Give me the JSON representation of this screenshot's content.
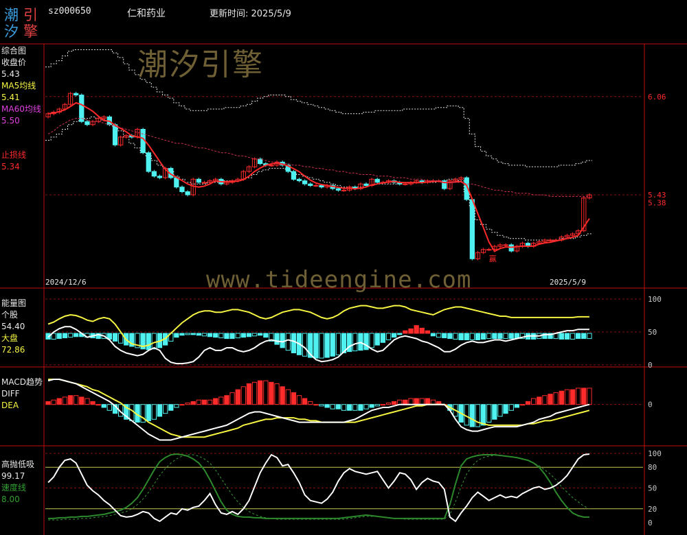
{
  "header": {
    "logo_chars": [
      "潮",
      "引",
      "汐",
      "擎"
    ],
    "code": "sz000650",
    "name": "仁和药业",
    "update_label": "更新时间: 2025/5/9"
  },
  "watermarks": {
    "cn": "潮汐引擎",
    "url": "www.tideengine.com"
  },
  "colors": {
    "red": "#ff2a2a",
    "cyan": "#4ef0f0",
    "yellow": "#f5f542",
    "white": "#ffffff",
    "green": "#2c8a2c",
    "magenta": "#e040e0",
    "frame": "#c01010"
  },
  "panel1": {
    "title": "综合图",
    "close_label": "收盘价",
    "close_value": "5.43",
    "ma5_label": "MA5均线",
    "ma5_value": "5.41",
    "ma60_label": "MA60均线",
    "ma60_value": "5.50",
    "stop_label": "止损线",
    "stop_value": "5.34",
    "date_start": "2024/12/6",
    "date_end": "2025/5/9",
    "marker": "赢"
  },
  "panel2": {
    "title": "能量图",
    "stock_label": "个股",
    "stock_value": "54.40",
    "market_label": "大盘",
    "market_value": "72.86"
  },
  "panel3": {
    "title": "MACD趋势",
    "diff_label": "DIFF",
    "dea_label": "DEA"
  },
  "panel4": {
    "title": "高抛低吸",
    "main_value": "99.17",
    "speed_label": "速度线",
    "speed_value": "8.00"
  },
  "chart_data": [
    {
      "type": "candlestick",
      "title": "综合图",
      "x_range": [
        "2024/12/6",
        "2025/5/9"
      ],
      "y_tick_labels": [
        "6.06",
        "5.43",
        "5.38"
      ],
      "ylim": [
        4.85,
        6.38
      ],
      "closes": [
        5.95,
        5.96,
        5.98,
        6.01,
        6.08,
        6.07,
        5.9,
        5.88,
        5.9,
        5.92,
        5.93,
        5.88,
        5.75,
        5.8,
        5.81,
        5.8,
        5.85,
        5.7,
        5.58,
        5.55,
        5.54,
        5.6,
        5.54,
        5.48,
        5.45,
        5.43,
        5.53,
        5.51,
        5.51,
        5.52,
        5.53,
        5.5,
        5.51,
        5.52,
        5.53,
        5.58,
        5.61,
        5.66,
        5.63,
        5.62,
        5.62,
        5.64,
        5.62,
        5.58,
        5.53,
        5.52,
        5.5,
        5.49,
        5.49,
        5.48,
        5.49,
        5.47,
        5.46,
        5.46,
        5.48,
        5.47,
        5.5,
        5.49,
        5.53,
        5.51,
        5.51,
        5.52,
        5.51,
        5.5,
        5.5,
        5.51,
        5.52,
        5.51,
        5.52,
        5.52,
        5.52,
        5.47,
        5.52,
        5.53,
        5.54,
        5.4,
        5.02,
        5.06,
        5.08,
        5.08,
        5.1,
        5.11,
        5.11,
        5.07,
        5.1,
        5.12,
        5.1,
        5.12,
        5.13,
        5.14,
        5.14,
        5.14,
        5.16,
        5.17,
        5.18,
        5.2,
        5.41,
        5.43
      ],
      "stop_line": [
        5.78,
        5.8,
        5.82,
        5.85,
        5.88,
        5.9,
        5.91,
        5.92,
        5.93,
        5.92,
        5.91,
        5.9,
        5.87,
        5.84,
        5.8,
        5.76,
        5.73,
        5.7,
        5.68,
        5.65,
        5.62,
        5.6,
        5.58,
        5.55,
        5.53,
        5.51,
        5.5,
        5.5,
        5.5,
        5.51,
        5.51,
        5.51,
        5.52,
        5.52,
        5.52,
        5.53,
        5.54,
        5.56,
        5.58,
        5.59,
        5.6,
        5.6,
        5.6,
        5.59,
        5.57,
        5.56,
        5.55,
        5.54,
        5.53,
        5.52,
        5.51,
        5.5,
        5.49,
        5.48,
        5.48,
        5.48,
        5.48,
        5.49,
        5.49,
        5.5,
        5.5,
        5.5,
        5.5,
        5.5,
        5.51,
        5.51,
        5.51,
        5.51,
        5.51,
        5.51,
        5.52,
        5.52,
        5.53,
        5.53,
        5.52,
        5.45,
        5.35,
        5.27,
        5.24,
        5.21,
        5.19,
        5.17,
        5.16,
        5.15,
        5.15,
        5.15,
        5.14,
        5.14,
        5.14,
        5.14,
        5.14,
        5.14,
        5.15,
        5.15,
        5.15,
        5.16,
        5.17,
        5.18
      ],
      "ma60": [
        5.82,
        5.84,
        5.87,
        5.89,
        5.91,
        5.92,
        5.92,
        5.91,
        5.9,
        5.9,
        5.89,
        5.88,
        5.87,
        5.86,
        5.85,
        5.84,
        5.83,
        5.82,
        5.81,
        5.8,
        5.79,
        5.78,
        5.77,
        5.76,
        5.76,
        5.75,
        5.74,
        5.73,
        5.73,
        5.72,
        5.71,
        5.7,
        5.7,
        5.69,
        5.68,
        5.68,
        5.67,
        5.66,
        5.66,
        5.65,
        5.64,
        5.64,
        5.63,
        5.63,
        5.62,
        5.62,
        5.61,
        5.61,
        5.6,
        5.6,
        5.59,
        5.59,
        5.58,
        5.58,
        5.57,
        5.57,
        5.56,
        5.56,
        5.56,
        5.55,
        5.55,
        5.55,
        5.54,
        5.54,
        5.54,
        5.53,
        5.53,
        5.53,
        5.52,
        5.52,
        5.52,
        5.51,
        5.51,
        5.51,
        5.51,
        5.5,
        5.5,
        5.49,
        5.48,
        5.47,
        5.46,
        5.46,
        5.45,
        5.45,
        5.44,
        5.44,
        5.44,
        5.43,
        5.43,
        5.43,
        5.42,
        5.42,
        5.42,
        5.42,
        5.42,
        5.42,
        5.42,
        5.42
      ]
    },
    {
      "type": "bar+line",
      "title": "能量图",
      "y_tick_labels": [
        "100",
        "50",
        "0"
      ],
      "ylim": [
        0,
        100
      ],
      "bars": [
        -9,
        -9,
        -8,
        -7,
        -6,
        -5,
        -5,
        -6,
        -7,
        -8,
        -8,
        -9,
        -12,
        -15,
        -18,
        -20,
        -22,
        -24,
        -25,
        -24,
        -22,
        -18,
        -12,
        -6,
        -3,
        -2,
        -2,
        -3,
        -4,
        -5,
        -6,
        -7,
        -8,
        -8,
        -7,
        -6,
        -5,
        -4,
        -3,
        -6,
        -12,
        -17,
        -22,
        -26,
        -30,
        -33,
        -35,
        -37,
        -38,
        -38,
        -37,
        -35,
        -33,
        -30,
        -28,
        -27,
        -26,
        -25,
        -22,
        -18,
        -14,
        -10,
        -6,
        -2,
        4,
        7,
        12,
        8,
        4,
        -4,
        -6,
        -7,
        -8,
        -9,
        -10,
        -10,
        -10,
        -10,
        -9,
        -8,
        -8,
        -8,
        -8,
        -8,
        -8,
        -8,
        -9,
        -9,
        -8,
        -8,
        -8,
        -8,
        -9,
        -9,
        -9,
        -8,
        -8,
        -8
      ],
      "stock_line": [
        42,
        50,
        55,
        58,
        58,
        54,
        48,
        42,
        44,
        46,
        44,
        38,
        28,
        22,
        18,
        16,
        14,
        16,
        22,
        26,
        22,
        10,
        4,
        2,
        2,
        3,
        5,
        12,
        22,
        26,
        22,
        22,
        26,
        26,
        22,
        20,
        22,
        26,
        32,
        36,
        38,
        36,
        35,
        38,
        36,
        32,
        26,
        16,
        8,
        5,
        6,
        8,
        12,
        20,
        28,
        32,
        34,
        30,
        24,
        20,
        22,
        30,
        38,
        42,
        44,
        42,
        40,
        36,
        34,
        30,
        26,
        20,
        20,
        24,
        30,
        34,
        36,
        34,
        34,
        36,
        38,
        38,
        36,
        38,
        40,
        42,
        44,
        44,
        44,
        46,
        46,
        48,
        50,
        52,
        52,
        54,
        54,
        54
      ],
      "market_line": [
        62,
        65,
        70,
        74,
        76,
        75,
        72,
        68,
        66,
        70,
        72,
        70,
        62,
        50,
        38,
        32,
        30,
        28,
        30,
        34,
        36,
        40,
        48,
        56,
        64,
        70,
        76,
        80,
        82,
        82,
        80,
        80,
        82,
        84,
        84,
        82,
        80,
        76,
        72,
        70,
        72,
        76,
        80,
        82,
        84,
        84,
        82,
        80,
        76,
        72,
        70,
        72,
        76,
        82,
        86,
        88,
        90,
        90,
        88,
        86,
        86,
        88,
        90,
        90,
        88,
        84,
        82,
        80,
        78,
        76,
        80,
        84,
        86,
        88,
        88,
        86,
        84,
        82,
        80,
        78,
        76,
        74,
        74,
        72,
        72,
        72,
        72,
        72,
        72,
        72,
        72,
        72,
        72,
        72,
        72,
        73,
        73,
        73
      ]
    },
    {
      "type": "bar+line",
      "title": "MACD趋势",
      "y_tick_labels": [
        "0"
      ],
      "ylim": [
        -0.27,
        0.23
      ],
      "macd_bars": [
        0.02,
        0.03,
        0.04,
        0.05,
        0.06,
        0.06,
        0.05,
        0.04,
        0.02,
        0.0,
        -0.02,
        -0.04,
        -0.06,
        -0.08,
        -0.1,
        -0.11,
        -0.12,
        -0.12,
        -0.11,
        -0.1,
        -0.08,
        -0.06,
        -0.04,
        -0.02,
        0.0,
        0.01,
        0.02,
        0.03,
        0.03,
        0.03,
        0.04,
        0.05,
        0.06,
        0.08,
        0.1,
        0.12,
        0.14,
        0.15,
        0.16,
        0.16,
        0.15,
        0.14,
        0.12,
        0.1,
        0.08,
        0.06,
        0.04,
        0.02,
        0.0,
        -0.01,
        -0.02,
        -0.03,
        -0.03,
        -0.04,
        -0.04,
        -0.04,
        -0.04,
        -0.03,
        -0.02,
        -0.01,
        0.0,
        0.01,
        0.02,
        0.03,
        0.03,
        0.04,
        0.04,
        0.04,
        0.04,
        0.03,
        0.02,
        0.0,
        -0.04,
        -0.08,
        -0.12,
        -0.14,
        -0.15,
        -0.15,
        -0.14,
        -0.12,
        -0.1,
        -0.08,
        -0.06,
        -0.04,
        -0.02,
        0.0,
        0.02,
        0.04,
        0.05,
        0.06,
        0.07,
        0.08,
        0.09,
        0.1,
        0.1,
        0.11,
        0.11,
        0.11
      ],
      "diff": [
        0.16,
        0.17,
        0.17,
        0.16,
        0.15,
        0.14,
        0.12,
        0.1,
        0.08,
        0.06,
        0.04,
        0.02,
        -0.01,
        -0.05,
        -0.08,
        -0.11,
        -0.14,
        -0.17,
        -0.2,
        -0.22,
        -0.24,
        -0.24,
        -0.24,
        -0.23,
        -0.22,
        -0.21,
        -0.2,
        -0.19,
        -0.18,
        -0.17,
        -0.16,
        -0.15,
        -0.14,
        -0.12,
        -0.1,
        -0.08,
        -0.06,
        -0.05,
        -0.05,
        -0.06,
        -0.07,
        -0.08,
        -0.09,
        -0.1,
        -0.11,
        -0.12,
        -0.12,
        -0.12,
        -0.12,
        -0.12,
        -0.12,
        -0.12,
        -0.12,
        -0.12,
        -0.11,
        -0.1,
        -0.08,
        -0.06,
        -0.04,
        -0.03,
        -0.02,
        -0.02,
        -0.01,
        0.0,
        0.0,
        0.0,
        0.0,
        0.0,
        0.0,
        0.0,
        0.0,
        0.0,
        -0.04,
        -0.1,
        -0.15,
        -0.17,
        -0.18,
        -0.18,
        -0.17,
        -0.16,
        -0.15,
        -0.15,
        -0.15,
        -0.15,
        -0.15,
        -0.14,
        -0.13,
        -0.12,
        -0.1,
        -0.09,
        -0.08,
        -0.06,
        -0.05,
        -0.04,
        -0.03,
        -0.02,
        -0.01,
        0.0
      ],
      "dea": [
        0.17,
        0.17,
        0.17,
        0.16,
        0.15,
        0.14,
        0.13,
        0.12,
        0.1,
        0.09,
        0.07,
        0.05,
        0.03,
        0.01,
        -0.02,
        -0.04,
        -0.07,
        -0.09,
        -0.12,
        -0.14,
        -0.16,
        -0.18,
        -0.2,
        -0.21,
        -0.22,
        -0.22,
        -0.22,
        -0.22,
        -0.22,
        -0.21,
        -0.2,
        -0.19,
        -0.18,
        -0.17,
        -0.16,
        -0.14,
        -0.13,
        -0.12,
        -0.11,
        -0.1,
        -0.1,
        -0.09,
        -0.09,
        -0.09,
        -0.09,
        -0.1,
        -0.1,
        -0.11,
        -0.11,
        -0.12,
        -0.12,
        -0.12,
        -0.12,
        -0.12,
        -0.12,
        -0.12,
        -0.11,
        -0.1,
        -0.09,
        -0.08,
        -0.07,
        -0.06,
        -0.05,
        -0.04,
        -0.03,
        -0.02,
        -0.01,
        -0.01,
        0.0,
        0.0,
        0.0,
        0.0,
        -0.02,
        -0.04,
        -0.06,
        -0.08,
        -0.1,
        -0.12,
        -0.13,
        -0.14,
        -0.14,
        -0.14,
        -0.14,
        -0.14,
        -0.14,
        -0.14,
        -0.13,
        -0.13,
        -0.12,
        -0.11,
        -0.11,
        -0.1,
        -0.09,
        -0.08,
        -0.07,
        -0.06,
        -0.05,
        -0.04
      ]
    },
    {
      "type": "line",
      "title": "高抛低吸",
      "y_tick_labels": [
        "100",
        "80",
        "50",
        "20",
        "0"
      ],
      "ylim": [
        0,
        100
      ],
      "main_line": [
        58,
        66,
        80,
        90,
        92,
        86,
        70,
        54,
        46,
        40,
        32,
        26,
        18,
        10,
        8,
        9,
        12,
        16,
        14,
        6,
        2,
        8,
        14,
        12,
        20,
        18,
        22,
        24,
        32,
        42,
        26,
        14,
        12,
        16,
        12,
        20,
        32,
        52,
        72,
        86,
        98,
        94,
        82,
        84,
        72,
        58,
        40,
        32,
        30,
        28,
        34,
        44,
        60,
        72,
        78,
        74,
        72,
        70,
        72,
        74,
        62,
        50,
        60,
        72,
        70,
        62,
        48,
        58,
        64,
        60,
        58,
        48,
        8,
        2,
        14,
        24,
        36,
        44,
        38,
        32,
        36,
        40,
        36,
        38,
        36,
        42,
        46,
        50,
        52,
        48,
        50,
        54,
        60,
        68,
        80,
        92,
        98,
        99
      ],
      "speed_line": [
        6,
        6,
        7,
        7,
        8,
        8,
        9,
        9,
        10,
        11,
        12,
        14,
        16,
        18,
        22,
        28,
        36,
        48,
        62,
        76,
        88,
        94,
        98,
        99,
        98,
        96,
        92,
        86,
        76,
        62,
        46,
        30,
        18,
        12,
        9,
        8,
        8,
        7,
        7,
        6,
        6,
        6,
        6,
        6,
        6,
        6,
        6,
        6,
        6,
        6,
        6,
        6,
        6,
        7,
        8,
        9,
        10,
        11,
        10,
        9,
        8,
        7,
        6,
        6,
        6,
        6,
        6,
        6,
        6,
        6,
        6,
        6,
        26,
        56,
        82,
        92,
        95,
        97,
        98,
        98,
        98,
        97,
        96,
        95,
        94,
        92,
        90,
        86,
        80,
        70,
        58,
        44,
        32,
        22,
        14,
        10,
        8,
        8
      ],
      "dashed_line": [
        4,
        4,
        4,
        5,
        5,
        5,
        6,
        6,
        7,
        8,
        9,
        10,
        12,
        14,
        16,
        20,
        26,
        34,
        44,
        56,
        68,
        78,
        86,
        92,
        96,
        98,
        98,
        96,
        92,
        86,
        76,
        64,
        52,
        40,
        30,
        22,
        16,
        12,
        9,
        7,
        6,
        5,
        5,
        5,
        5,
        5,
        5,
        5,
        5,
        5,
        5,
        5,
        5,
        5,
        6,
        7,
        8,
        9,
        9,
        9,
        8,
        7,
        6,
        6,
        5,
        5,
        5,
        5,
        5,
        5,
        5,
        5,
        12,
        30,
        52,
        70,
        82,
        90,
        94,
        96,
        97,
        97,
        96,
        95,
        94,
        92,
        90,
        86,
        82,
        76,
        70,
        62,
        52,
        44,
        36,
        30,
        24,
        20
      ]
    }
  ]
}
